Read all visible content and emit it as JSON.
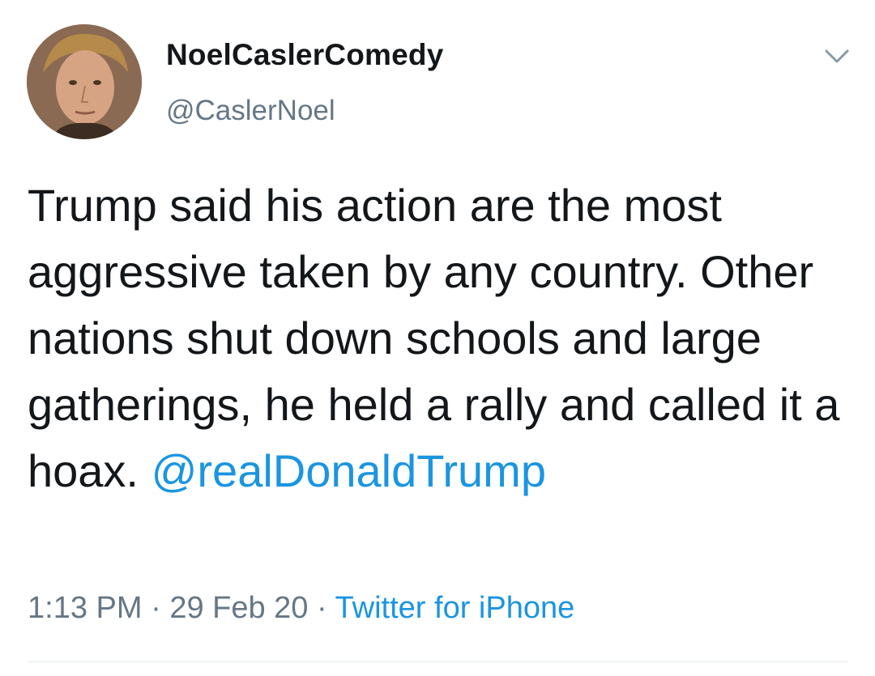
{
  "author": {
    "display_name": "NoelCaslerComedy",
    "handle": "@CaslerNoel"
  },
  "tweet": {
    "text": "Trump said his action are the most aggressive taken by any country. Other nations shut down schools and large gatherings, he held a rally and called it a hoax.",
    "mention": "@realDonaldTrump"
  },
  "meta": {
    "time": "1:13 PM",
    "separator": "·",
    "date": "29 Feb 20",
    "source": "Twitter for iPhone"
  },
  "icons": {
    "menu": "chevron-down-icon"
  },
  "colors": {
    "link": "#1b95e0",
    "secondary_text": "#657786",
    "primary_text": "#14171a"
  }
}
